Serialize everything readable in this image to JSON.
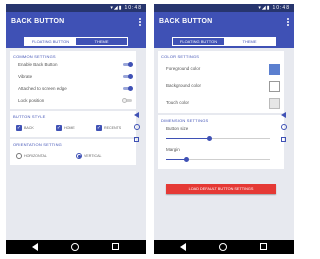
{
  "status_bar": {
    "time": "10:48",
    "icons": "▾◢▮"
  },
  "app_title": "BACK BUTTON",
  "tabs": {
    "floating": "FLOATING BUTTON",
    "theme": "THEME"
  },
  "left": {
    "common_settings": {
      "title": "COMMON SETTINGS",
      "items": [
        {
          "label": "Enable Back Button",
          "on": true
        },
        {
          "label": "Vibrate",
          "on": true
        },
        {
          "label": "Attached to screen edge",
          "on": true
        },
        {
          "label": "Lock position",
          "on": false
        }
      ]
    },
    "button_style": {
      "title": "BUTTON STYLE",
      "options": [
        {
          "label": "BACK",
          "checked": true
        },
        {
          "label": "HOME",
          "checked": true
        },
        {
          "label": "RECENTS",
          "checked": true
        }
      ]
    },
    "orientation": {
      "title": "ORIENTATION SETTING",
      "options": [
        {
          "label": "HORIZONTAL",
          "checked": false
        },
        {
          "label": "VERTICAL",
          "checked": true
        }
      ]
    }
  },
  "right": {
    "color_settings": {
      "title": "COLOR SETTINGS",
      "items": [
        {
          "label": "Foreground color",
          "color": "#5b7fcf"
        },
        {
          "label": "Background color",
          "color": "#ffffff"
        },
        {
          "label": "Touch color",
          "color": "#e6e6e6"
        }
      ]
    },
    "dimension_settings": {
      "title": "DIMENSION SETTINGS",
      "button_size": {
        "label": "Button size",
        "value": 0.42
      },
      "margin": {
        "label": "Margin",
        "value": 0.2
      }
    },
    "reset_button": "LOAD DEFAULT BUTTON SETTINGS"
  },
  "colors": {
    "primary": "#3f51b5",
    "status_bar": "#27356e",
    "danger": "#e53935"
  }
}
